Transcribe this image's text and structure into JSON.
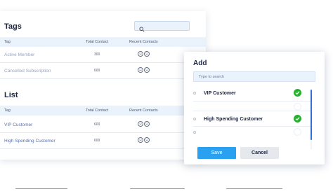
{
  "tags": {
    "title": "Tags",
    "columns": {
      "name": "Tag",
      "total": "Total Contact",
      "recent": "Recent Contacts"
    },
    "rows": [
      {
        "name": "Active Member",
        "total": "300"
      },
      {
        "name": "Cancelled Subscription",
        "total": "600"
      }
    ]
  },
  "list": {
    "title": "List",
    "columns": {
      "name": "Tag",
      "total": "Total Contact",
      "recent": "Recent Contacts"
    },
    "rows": [
      {
        "name": "VIP Customer",
        "total": "600"
      },
      {
        "name": "High Spending Customer",
        "total": "600"
      }
    ]
  },
  "modal": {
    "title": "Add",
    "search_placeholder": "Type to search",
    "options": [
      {
        "label": "VIP Customer",
        "selected": true
      },
      {
        "label": "",
        "selected": false
      },
      {
        "label": "High Spending Customer",
        "selected": true
      },
      {
        "label": "",
        "selected": false
      }
    ],
    "save_label": "Save",
    "cancel_label": "Cancel"
  },
  "colors": {
    "accent": "#2aa1f0",
    "check": "#28b12e",
    "header_bg": "#eaf2fc"
  }
}
